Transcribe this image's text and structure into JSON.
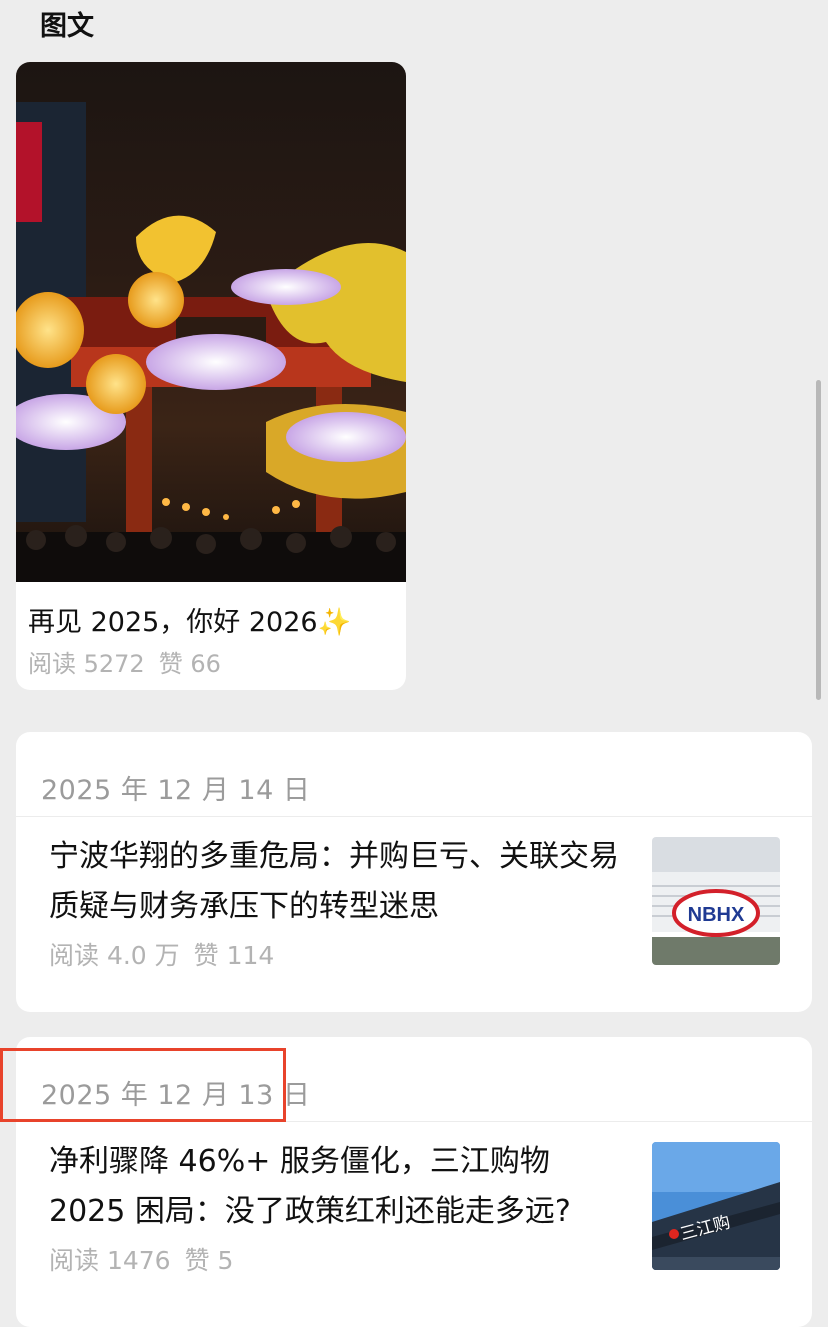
{
  "section": {
    "title": "图文"
  },
  "featured": {
    "title": "再见 2025，你好 2026✨",
    "reads": "阅读 5272",
    "likes": "赞 66"
  },
  "articles": [
    {
      "date": "2025 年 12 月 14 日",
      "title": "宁波华翔的多重危局：并购巨亏、关联交易质疑与财务承压下的转型迷思",
      "reads": "阅读 4.0 万",
      "likes": "赞 114",
      "thumb_logo": "NBHX"
    },
    {
      "date": "2025 年 12 月 13 日",
      "title": "净利骤降 46%+ 服务僵化，三江购物 2025 困局：没了政策红利还能走多远?",
      "reads": "阅读 1476",
      "likes": "赞 5",
      "thumb_sign": "三江购"
    }
  ],
  "colors": {
    "background": "#ededed",
    "highlight": "#e8432b",
    "meta_text": "#b3b3b3"
  }
}
